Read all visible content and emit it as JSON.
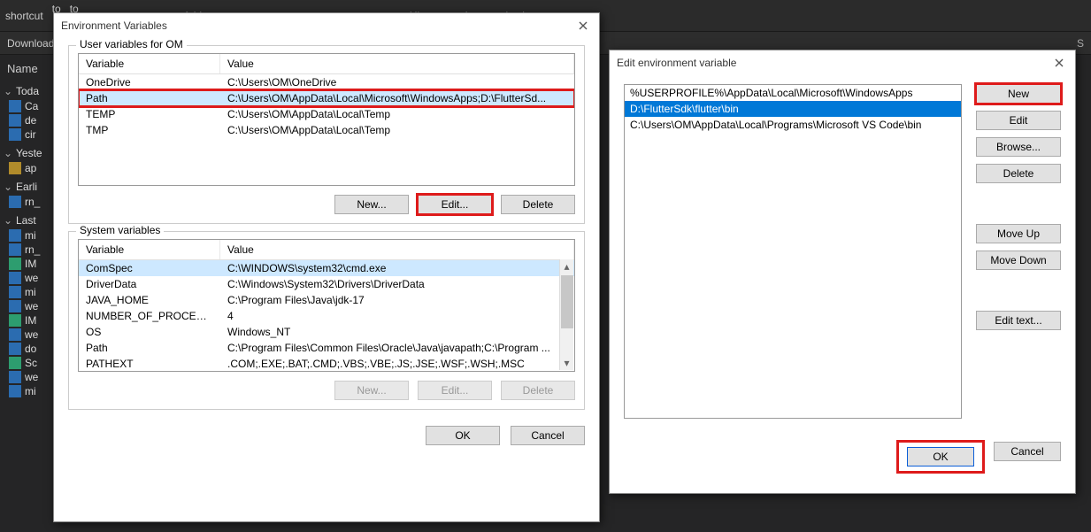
{
  "explorer": {
    "toolbar": {
      "shortcut": "shortcut",
      "to1": "to",
      "to2": "to",
      "folder": "folder",
      "history": "History",
      "invert": "Invert selection"
    },
    "breadcrumb": "Downloads",
    "name_header": "Name",
    "groups": [
      {
        "label": "Toda",
        "items": [
          {
            "icon": "doc",
            "name": "Ca"
          },
          {
            "icon": "doc",
            "name": "de"
          },
          {
            "icon": "doc",
            "name": "cir"
          }
        ]
      },
      {
        "label": "Yeste",
        "items": [
          {
            "icon": "zip",
            "name": "ap"
          }
        ]
      },
      {
        "label": "Earli",
        "items": [
          {
            "icon": "doc",
            "name": "rn_"
          }
        ]
      },
      {
        "label": "Last ",
        "items": [
          {
            "icon": "doc",
            "name": "mi"
          },
          {
            "icon": "doc",
            "name": "rn_"
          },
          {
            "icon": "img",
            "name": "IM"
          },
          {
            "icon": "doc",
            "name": "we"
          },
          {
            "icon": "doc",
            "name": "mi"
          },
          {
            "icon": "doc",
            "name": "we"
          },
          {
            "icon": "img",
            "name": "IM"
          },
          {
            "icon": "doc",
            "name": "we"
          },
          {
            "icon": "doc",
            "name": "do"
          },
          {
            "icon": "img",
            "name": "Sc"
          },
          {
            "icon": "doc",
            "name": "we"
          },
          {
            "icon": "doc",
            "name": "mi"
          }
        ]
      }
    ]
  },
  "env_dialog": {
    "title": "Environment Variables",
    "user_group_title": "User variables for OM",
    "sys_group_title": "System variables",
    "columns": {
      "variable": "Variable",
      "value": "Value"
    },
    "user_rows": [
      {
        "variable": "OneDrive",
        "value": "C:\\Users\\OM\\OneDrive"
      },
      {
        "variable": "Path",
        "value": "C:\\Users\\OM\\AppData\\Local\\Microsoft\\WindowsApps;D:\\FlutterSd..."
      },
      {
        "variable": "TEMP",
        "value": "C:\\Users\\OM\\AppData\\Local\\Temp"
      },
      {
        "variable": "TMP",
        "value": "C:\\Users\\OM\\AppData\\Local\\Temp"
      }
    ],
    "sys_rows": [
      {
        "variable": "ComSpec",
        "value": "C:\\WINDOWS\\system32\\cmd.exe"
      },
      {
        "variable": "DriverData",
        "value": "C:\\Windows\\System32\\Drivers\\DriverData"
      },
      {
        "variable": "JAVA_HOME",
        "value": "C:\\Program Files\\Java\\jdk-17"
      },
      {
        "variable": "NUMBER_OF_PROCESSORS",
        "value": "4"
      },
      {
        "variable": "OS",
        "value": "Windows_NT"
      },
      {
        "variable": "Path",
        "value": "C:\\Program Files\\Common Files\\Oracle\\Java\\javapath;C:\\Program ..."
      },
      {
        "variable": "PATHEXT",
        "value": ".COM;.EXE;.BAT;.CMD;.VBS;.VBE;.JS;.JSE;.WSF;.WSH;.MSC"
      }
    ],
    "buttons": {
      "new": "New...",
      "edit": "Edit...",
      "delete": "Delete",
      "ok": "OK",
      "cancel": "Cancel"
    }
  },
  "edit_dialog": {
    "title": "Edit environment variable",
    "paths": [
      "%USERPROFILE%\\AppData\\Local\\Microsoft\\WindowsApps",
      "D:\\FlutterSdk\\flutter\\bin",
      "C:\\Users\\OM\\AppData\\Local\\Programs\\Microsoft VS Code\\bin"
    ],
    "selected_index": 1,
    "buttons": {
      "new": "New",
      "edit": "Edit",
      "browse": "Browse...",
      "delete": "Delete",
      "moveup": "Move Up",
      "movedown": "Move Down",
      "edittext": "Edit text...",
      "ok": "OK",
      "cancel": "Cancel"
    }
  }
}
